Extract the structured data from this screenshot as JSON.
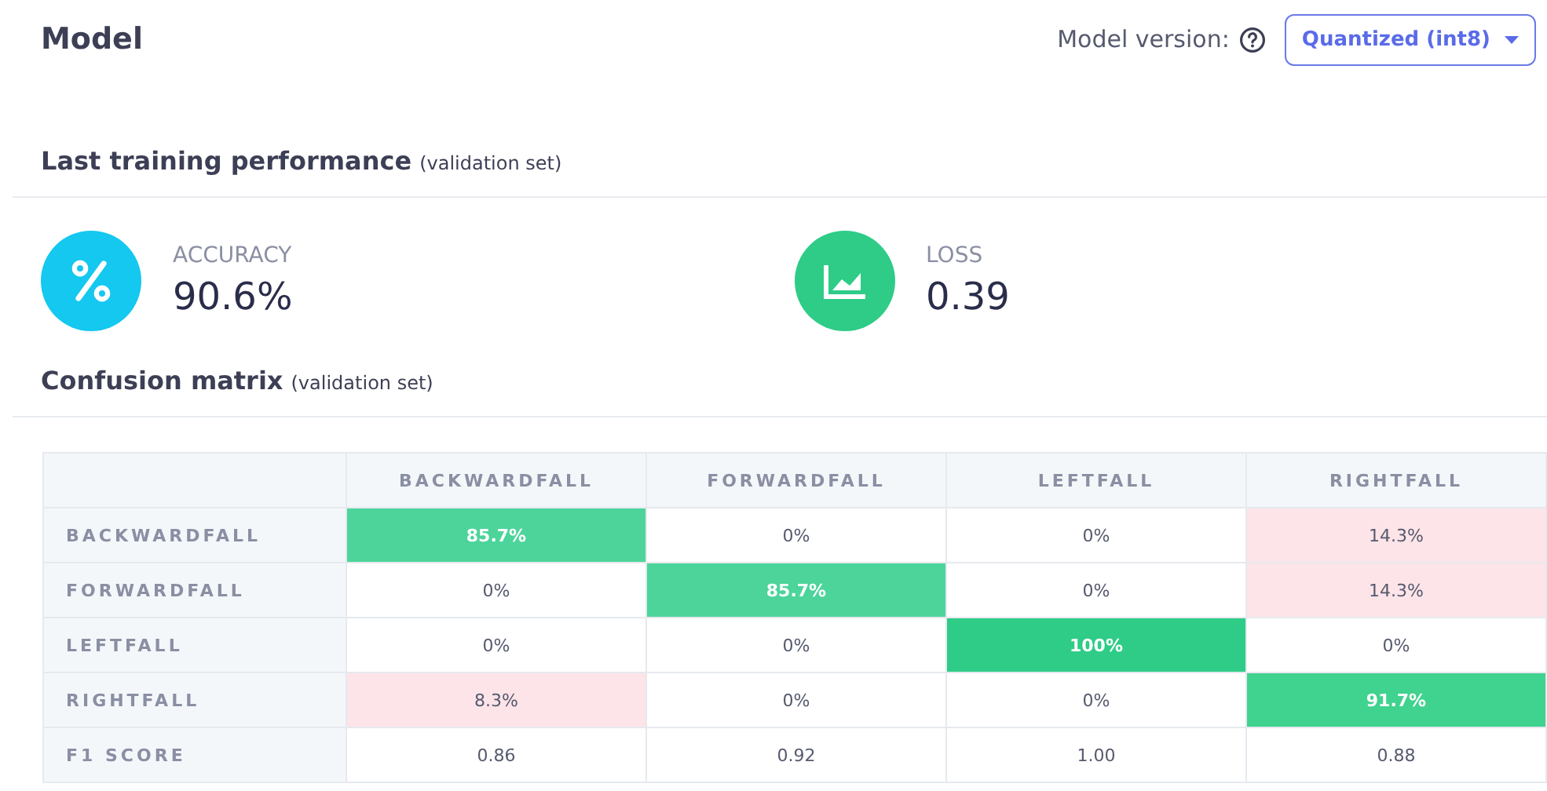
{
  "title": "Model",
  "version": {
    "label": "Model version:",
    "value": "Quantized (int8)"
  },
  "performance": {
    "heading": "Last training performance",
    "note": "(validation set)",
    "metrics": [
      {
        "kind": "percent",
        "label": "ACCURACY",
        "value": "90.6%"
      },
      {
        "kind": "chart",
        "label": "LOSS",
        "value": "0.39"
      }
    ]
  },
  "confusion": {
    "heading": "Confusion matrix",
    "note": "(validation set)",
    "columns": [
      "BACKWARDFALL",
      "FORWARDFALL",
      "LEFTFALL",
      "RIGHTFALL"
    ],
    "rows": [
      {
        "label": "BACKWARDFALL",
        "cells": [
          {
            "text": "85.7%",
            "color": "#4cd49a"
          },
          {
            "text": "0%"
          },
          {
            "text": "0%"
          },
          {
            "text": "14.3%",
            "color": "#fde4e8"
          }
        ]
      },
      {
        "label": "FORWARDFALL",
        "cells": [
          {
            "text": "0%"
          },
          {
            "text": "85.7%",
            "color": "#4cd49a"
          },
          {
            "text": "0%"
          },
          {
            "text": "14.3%",
            "color": "#fde4e8"
          }
        ]
      },
      {
        "label": "LEFTFALL",
        "cells": [
          {
            "text": "0%"
          },
          {
            "text": "0%"
          },
          {
            "text": "100%",
            "color": "#2ecc87"
          },
          {
            "text": "0%"
          }
        ]
      },
      {
        "label": "RIGHTFALL",
        "cells": [
          {
            "text": "8.3%",
            "color": "#fde4e8"
          },
          {
            "text": "0%"
          },
          {
            "text": "0%"
          },
          {
            "text": "91.7%",
            "color": "#40d28f"
          }
        ]
      },
      {
        "label": "F1 SCORE",
        "cells": [
          {
            "text": "0.86"
          },
          {
            "text": "0.92"
          },
          {
            "text": "1.00"
          },
          {
            "text": "0.88"
          }
        ]
      }
    ]
  }
}
